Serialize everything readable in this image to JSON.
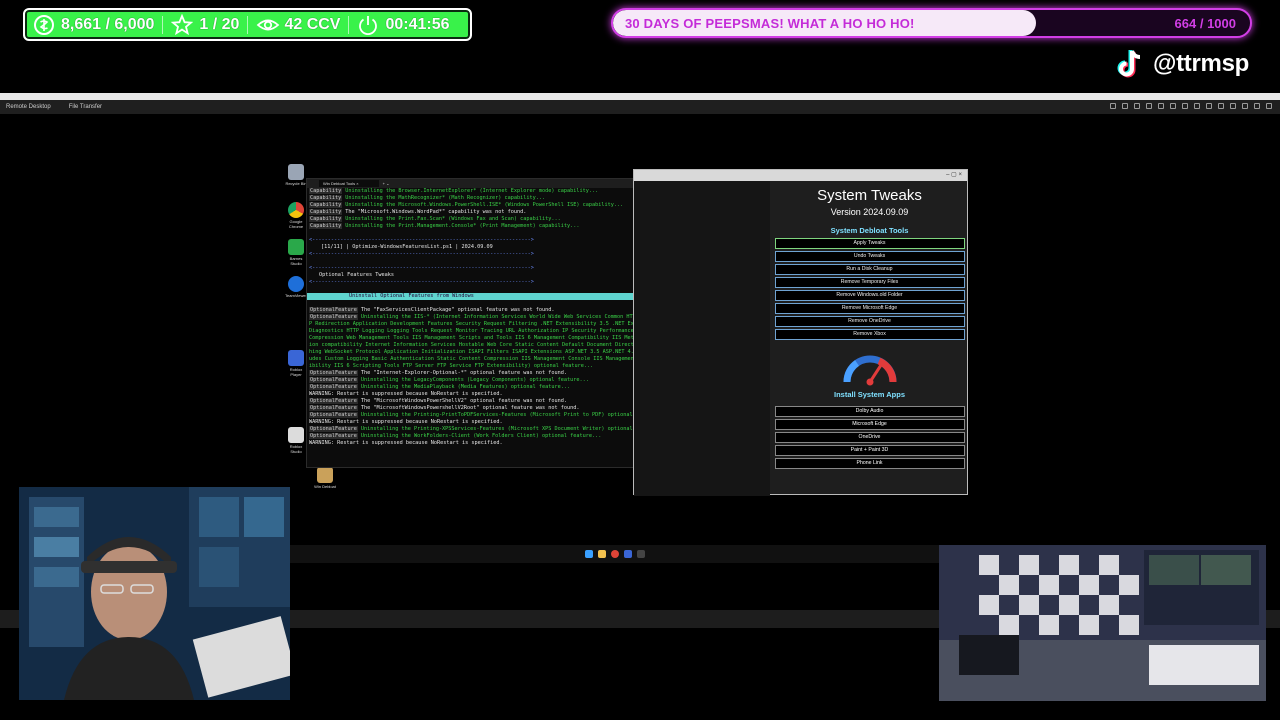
{
  "overlay": {
    "stats": {
      "points": "8,661 / 6,000",
      "stars": "1 / 20",
      "viewers": "42 CCV",
      "timer": "00:41:56"
    },
    "goal": {
      "text": "30 DAYS OF PEEPSMAS! WHAT A HO HO HO!",
      "count": "664 / 1000",
      "progress": 0.664
    },
    "tiktok_handle": "@ttrmsp"
  },
  "remote_desktop": {
    "menu_items": [
      "Remote Desktop",
      "File Transfer"
    ]
  },
  "desktop_icons": [
    {
      "label": "Recycle Bin",
      "color": "#9aa5b5"
    },
    {
      "label": "Google Chrome",
      "color": "#de4437"
    },
    {
      "label": "Barnes Studio",
      "color": "#2aa84a"
    },
    {
      "label": "TeamViewer",
      "color": "#1e6fd9"
    },
    {
      "label": "Roblox Player",
      "color": "#3a66d6"
    },
    {
      "label": "Roblox Studio",
      "color": "#dcdcdc"
    },
    {
      "label": "Win Debloat",
      "color": "#caa15a"
    }
  ],
  "terminal": {
    "tab_title": "Win Debloat Tools",
    "lines": [
      {
        "tag": "Capability",
        "text": "Uninstalling the Browser.InternetExplorer* (Internet Explorer mode) capability...",
        "cls": "green"
      },
      {
        "tag": "Capability",
        "text": "Uninstalling the MathRecognizer* (Math Recognizer) capability...",
        "cls": "green"
      },
      {
        "tag": "Capability",
        "text": "Uninstalling the Microsoft.Windows.PowerShell.ISE* (Windows PowerShell ISE) capability...",
        "cls": "green"
      },
      {
        "tag": "Capability",
        "text": "The \"Microsoft.Windows.WordPad*\" capability was not found.",
        "cls": "white"
      },
      {
        "tag": "Capability",
        "text": "Uninstalling the Print.Fax.Scan* (Windows Fax and Scan) capability...",
        "cls": "green"
      },
      {
        "tag": "Capability",
        "text": "Uninstalling the Print.Management.Console* (Print Management) capability...",
        "cls": "green"
      }
    ],
    "section_header": "[11/11] | Optimize-WindowsFeaturesList.ps1 | 2024.09.09",
    "subsection": "Optional Features Tweaks",
    "banner": "Uninstall Optional Features from Windows",
    "lines2": [
      {
        "tag": "OptionalFeature",
        "text": "The \"FaxServicesClientPackage\" optional feature was not found.",
        "cls": "white"
      },
      {
        "tag": "OptionalFeature",
        "text": "Uninstalling the IIS-* (Internet Information Services World Wide Web Services Common HTTP Features HTTP Errors HTTP Redirection Application Development Features Security Request Filtering .NET Extensibility 3.5 .NET Extensibility 4.8 Health and Diagnostics HTTP Logging Logging Tools Request Monitor Tracing URL Authorization IP Security Performance Features Dynamic Content Compression Web Management Tools IIS Management Scripts and Tools IIS 6 Management Compatibility IIS Metabase and IIS 6 configuration compatibility Internet Information Services Hostable Web Core Static Content Default Document Directory Browsing WebDAV Publishing WebSocket Protocol Application Initialization ISAPI Filters ISAPI Extensions ASP.NET 3.5 ASP.NET 4.8 ASP CGI Server-Side Includes Custom Logging Basic Authentication Static Content Compression IIS Management Console IIS Management Service IIS 6 WMI Compatibility IIS 6 Scripting Tools FTP Server FTP Service FTP Extensibility) optional feature...",
        "cls": "green wrap"
      },
      {
        "tag": "OptionalFeature",
        "text": "The \"Internet-Explorer-Optional-*\" optional feature was not found.",
        "cls": "white"
      },
      {
        "tag": "OptionalFeature",
        "text": "Uninstalling the LegacyComponents (Legacy Components) optional feature...",
        "cls": "green"
      },
      {
        "tag": "OptionalFeature",
        "text": "Uninstalling the MediaPlayback (Media Features) optional feature...",
        "cls": "green"
      },
      {
        "tag": "",
        "text": "WARNING: Restart is suppressed because NoRestart is specified.",
        "cls": "warn"
      },
      {
        "tag": "OptionalFeature",
        "text": "The \"MicrosoftWindowsPowerShellV2\" optional feature was not found.",
        "cls": "white"
      },
      {
        "tag": "OptionalFeature",
        "text": "The \"MicrosoftWindowsPowershellV2Root\" optional feature was not found.",
        "cls": "white"
      },
      {
        "tag": "OptionalFeature",
        "text": "Uninstalling the Printing-PrintToPDFServices-Features (Microsoft Print to PDF) optional feature...",
        "cls": "green"
      },
      {
        "tag": "",
        "text": "WARNING: Restart is suppressed because NoRestart is specified.",
        "cls": "warn"
      },
      {
        "tag": "OptionalFeature",
        "text": "Uninstalling the Printing-XPSServices-Features (Microsoft XPS Document Writer) optional feature...",
        "cls": "green"
      },
      {
        "tag": "OptionalFeature",
        "text": "Uninstalling the WorkFolders-Client (Work Folders Client) optional feature...",
        "cls": "green"
      },
      {
        "tag": "",
        "text": "WARNING: Restart is suppressed because NoRestart is specified.",
        "cls": "warn"
      }
    ]
  },
  "tweaks_window": {
    "title": "System Tweaks",
    "version": "Version 2024.09.09",
    "debloat_header": "System Debloat Tools",
    "debloat_buttons": [
      "Apply Tweaks",
      "Undo Tweaks",
      "Run a Disk Cleanup",
      "Remove Temporary Files",
      "Remove Windows.old Folder",
      "Remove Microsoft Edge",
      "Remove OneDrive",
      "Remove Xbox"
    ],
    "apps_header": "Install System Apps",
    "app_buttons": [
      "Dolby Audio",
      "Microsoft Edge",
      "OneDrive",
      "Paint + Paint 3D",
      "Phone Link"
    ],
    "accent": "#7fe0ff"
  }
}
